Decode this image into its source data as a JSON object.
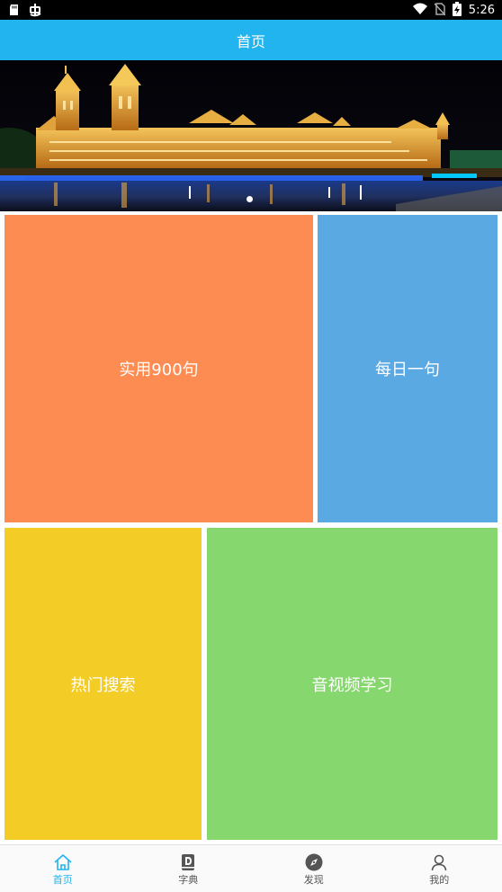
{
  "status_bar": {
    "time": "5:26",
    "icons": [
      "sd-card-icon",
      "bug-icon",
      "wifi-icon",
      "no-sim-icon",
      "battery-charging-icon"
    ]
  },
  "app_bar": {
    "title": "首页"
  },
  "banner": {
    "image": "night-palace-photo",
    "slide_count": 1,
    "active_slide": 1
  },
  "tiles": {
    "phrases_900": {
      "label": "实用900句",
      "color": "#fc8c51"
    },
    "daily_sentence": {
      "label": "每日一句",
      "color": "#5aa9e2"
    },
    "hot_search": {
      "label": "热门搜索",
      "color": "#f3cc26"
    },
    "av_learning": {
      "label": "音视频学习",
      "color": "#87d76f"
    }
  },
  "bottom_nav": {
    "active_color": "#22b4ef",
    "items": [
      {
        "label": "首页",
        "icon": "home-icon",
        "active": true
      },
      {
        "label": "字典",
        "icon": "dictionary-icon",
        "active": false
      },
      {
        "label": "发现",
        "icon": "compass-icon",
        "active": false
      },
      {
        "label": "我的",
        "icon": "user-icon",
        "active": false
      }
    ]
  }
}
